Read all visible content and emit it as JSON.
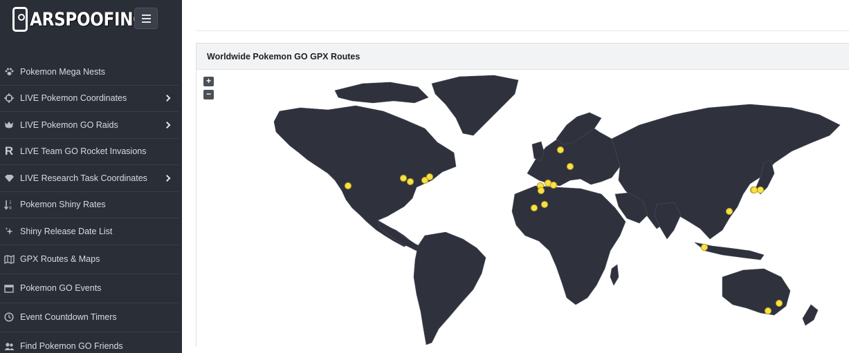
{
  "brand": {
    "name": "ARSPOOFING"
  },
  "sidebar": {
    "items": [
      {
        "label": "Pokemon Mega Nests",
        "icon": "paw-icon",
        "chevron": false
      },
      {
        "label": "LIVE Pokemon Coordinates",
        "icon": "crosshair-icon",
        "chevron": true
      },
      {
        "label": "LIVE Pokemon GO Raids",
        "icon": "raid-boss-icon",
        "chevron": true
      },
      {
        "label": "LIVE Team GO Rocket Invasions",
        "icon": "rocket-r-icon",
        "chevron": false
      },
      {
        "label": "LIVE Research Task Coordinates",
        "icon": "gem-icon",
        "chevron": true
      },
      {
        "label": "Pokemon Shiny Rates",
        "icon": "sort-numeric-icon",
        "chevron": false
      },
      {
        "label": "Shiny Release Date List",
        "icon": "sparkle-icon",
        "chevron": false
      },
      {
        "label": "GPX Routes & Maps",
        "icon": "map-icon",
        "chevron": false
      },
      {
        "label": "Pokemon GO Events",
        "icon": "calendar-icon",
        "chevron": false
      },
      {
        "label": "Event Countdown Timers",
        "icon": "clock-icon",
        "chevron": false
      },
      {
        "label": "Find Pokemon GO Friends",
        "icon": "users-icon",
        "chevron": false
      }
    ]
  },
  "panel": {
    "title": "Worldwide Pokemon GO GPX Routes",
    "zoom_in": "+",
    "zoom_out": "−"
  },
  "colors": {
    "sidebar_bg": "#2a2e37",
    "land": "#2f323d",
    "marker": "#f8e047"
  }
}
